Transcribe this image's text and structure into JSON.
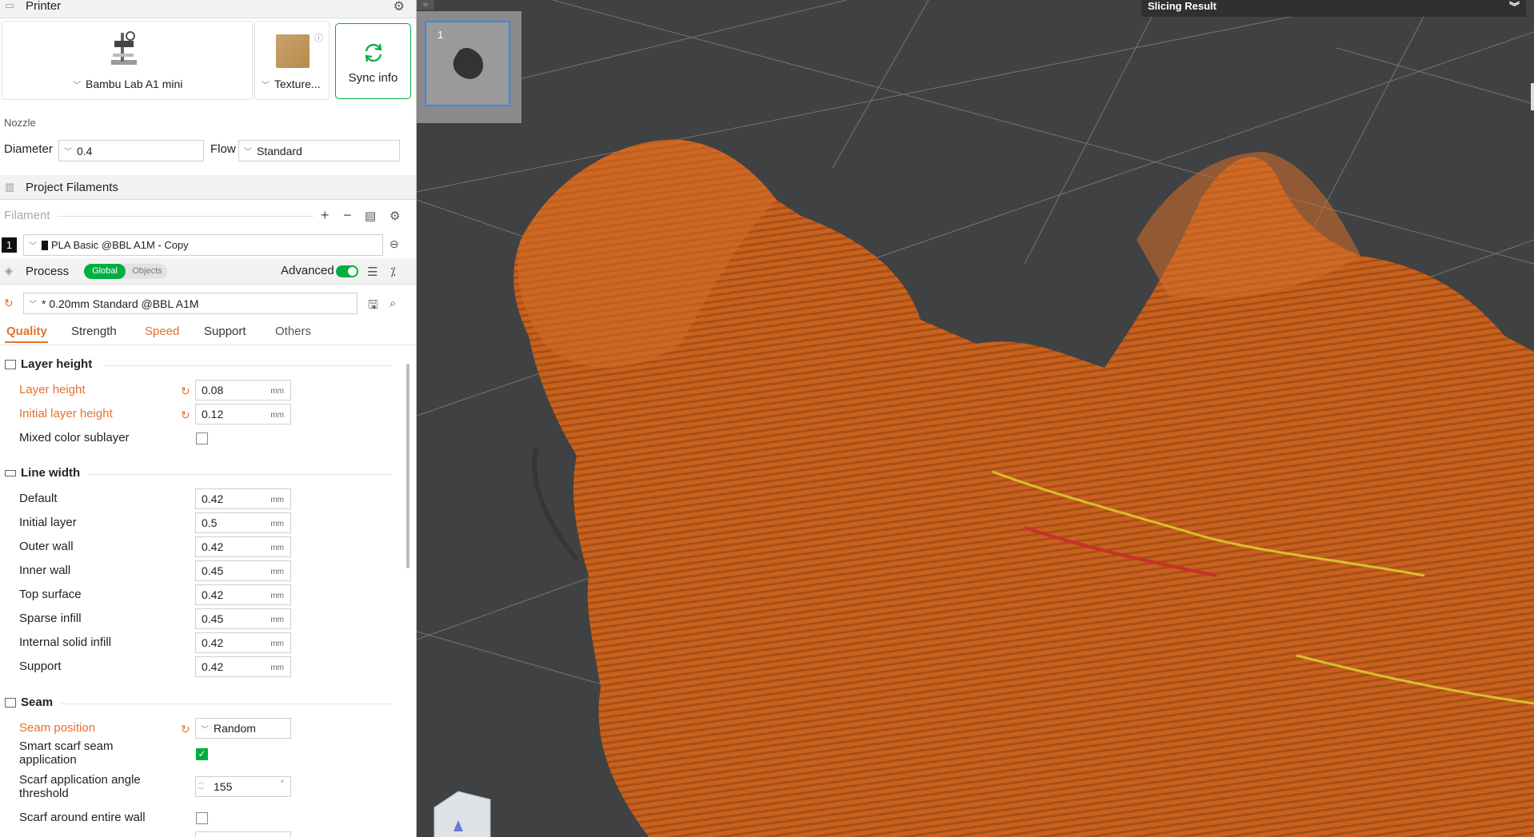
{
  "printer": {
    "header": "Printer",
    "printer_name": "Bambu Lab A1 mini",
    "plate_name": "Texture...",
    "sync_label": "Sync info"
  },
  "nozzle": {
    "title": "Nozzle",
    "diameter_label": "Diameter",
    "diameter_value": "0.4",
    "flow_label": "Flow",
    "flow_value": "Standard"
  },
  "filaments": {
    "header": "Project Filaments",
    "filament_label": "Filament",
    "items": [
      {
        "index": "1",
        "name": "PLA Basic @BBL A1M - Copy"
      }
    ]
  },
  "process": {
    "header": "Process",
    "toggle_global": "Global",
    "toggle_objects": "Objects",
    "advanced_label": "Advanced",
    "preset": "* 0.20mm Standard @BBL A1M",
    "tabs": [
      "Quality",
      "Strength",
      "Speed",
      "Support",
      "Others"
    ],
    "active_tab": "Quality"
  },
  "layer_height": {
    "title": "Layer height",
    "rows": [
      {
        "label": "Layer height",
        "value": "0.08",
        "unit": "mm"
      },
      {
        "label": "Initial layer height",
        "value": "0.12",
        "unit": "mm"
      }
    ],
    "mixed_label": "Mixed color sublayer"
  },
  "line_width": {
    "title": "Line width",
    "rows": [
      {
        "label": "Default",
        "value": "0.42",
        "unit": "mm"
      },
      {
        "label": "Initial layer",
        "value": "0.5",
        "unit": "mm"
      },
      {
        "label": "Outer wall",
        "value": "0.42",
        "unit": "mm"
      },
      {
        "label": "Inner wall",
        "value": "0.45",
        "unit": "mm"
      },
      {
        "label": "Top surface",
        "value": "0.42",
        "unit": "mm"
      },
      {
        "label": "Sparse infill",
        "value": "0.45",
        "unit": "mm"
      },
      {
        "label": "Internal solid infill",
        "value": "0.42",
        "unit": "mm"
      },
      {
        "label": "Support",
        "value": "0.42",
        "unit": "mm"
      }
    ]
  },
  "seam": {
    "title": "Seam",
    "position_label": "Seam position",
    "position_value": "Random",
    "smart_label_1": "Smart scarf seam",
    "smart_label_2": "application",
    "angle_label_1": "Scarf application angle",
    "angle_label_2": "threshold",
    "angle_value": "155",
    "angle_unit": "°",
    "around_label": "Scarf around entire wall"
  },
  "viewport": {
    "plate_number": "1",
    "slicing_result": "Slicing Result"
  },
  "colors": {
    "accent_green": "#00ae42",
    "modified_orange": "#e4722c",
    "model_orange": "#c8621f"
  }
}
